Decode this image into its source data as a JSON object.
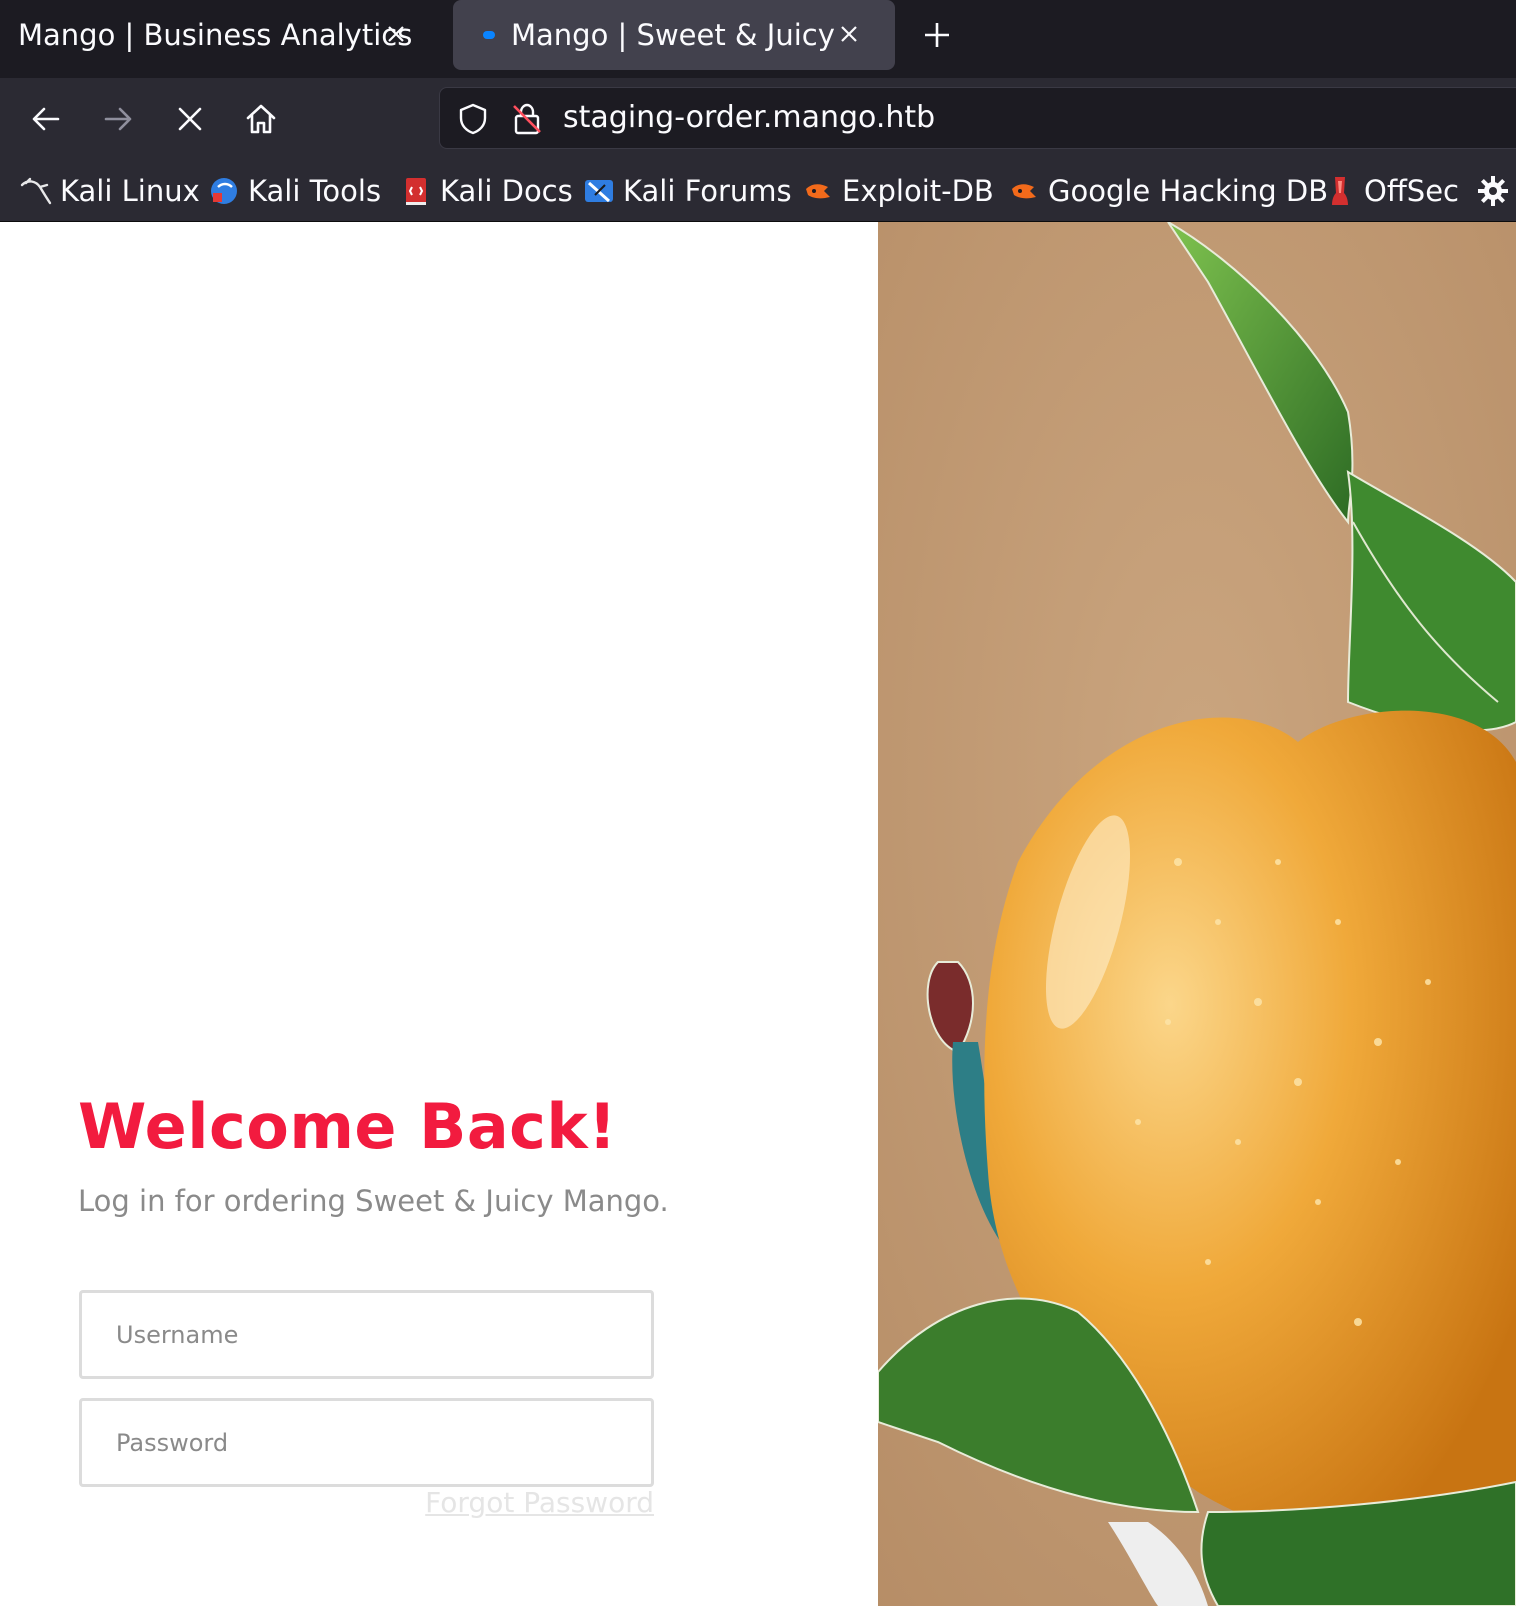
{
  "browser": {
    "tabs": [
      {
        "title": "Mango | Business Analytics",
        "active": false
      },
      {
        "title": "Mango | Sweet & Juicy",
        "active": true
      }
    ],
    "url": "staging-order.mango.htb",
    "bookmarks": [
      {
        "label": "Kali Linux",
        "icon": "kali-dragon-icon"
      },
      {
        "label": "Kali Tools",
        "icon": "kali-tools-icon"
      },
      {
        "label": "Kali Docs",
        "icon": "kali-docs-icon"
      },
      {
        "label": "Kali Forums",
        "icon": "kali-forums-icon"
      },
      {
        "label": "Exploit-DB",
        "icon": "exploit-db-icon"
      },
      {
        "label": "Google Hacking DB",
        "icon": "ghdb-icon"
      },
      {
        "label": "OffSec",
        "icon": "offsec-icon"
      }
    ]
  },
  "login": {
    "heading": "Welcome Back!",
    "subtitle": "Log in for ordering Sweet & Juicy Mango.",
    "username_placeholder": "Username",
    "password_placeholder": "Password",
    "forgot_label": "Forgot Password"
  },
  "colors": {
    "accent": "#f21b3f",
    "chrome_dark": "#1c1b22",
    "chrome_mid": "#2b2a33",
    "mango": "#f0a93a",
    "leaf": "#3f8a2f",
    "background_paper": "#c29b76"
  }
}
